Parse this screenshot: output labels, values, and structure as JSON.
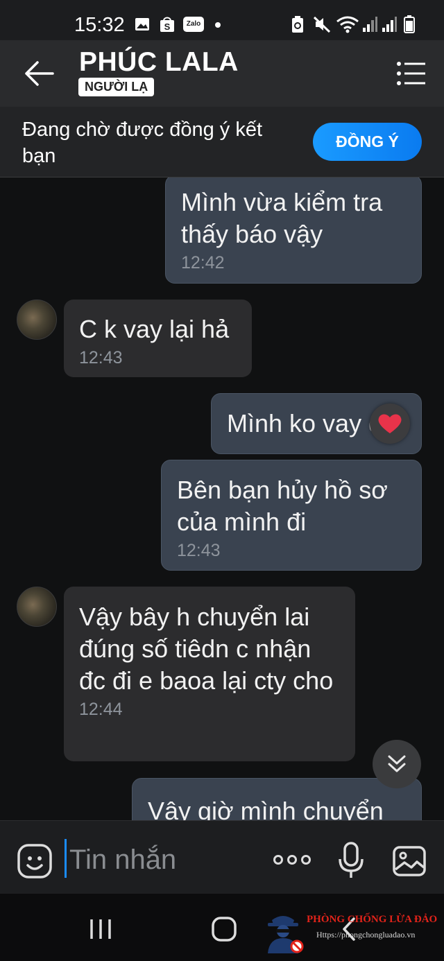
{
  "status_bar": {
    "time": "15:32",
    "icons": [
      "image-icon",
      "shopee-icon",
      "zalo-icon",
      "dot-icon",
      "battery-saver-icon",
      "mute-icon",
      "wifi-icon",
      "signal-icon",
      "signal-icon",
      "battery-icon"
    ],
    "zalo_label": "Zalo"
  },
  "header": {
    "contact_name": "PHÚC LALA",
    "badge": "NGƯỜI LẠ"
  },
  "friend_request": {
    "text": "Đang chờ được đồng ý kết bạn",
    "accept_label": "ĐỒNG Ý"
  },
  "messages": [
    {
      "side": "me",
      "text": "Mình vừa kiểm tra thấy báo vậy",
      "time": "12:42"
    },
    {
      "side": "them",
      "text": "C k vay lại hả",
      "time": "12:43"
    },
    {
      "side": "me",
      "text": "Mình ko vay đi",
      "time": "",
      "reaction": "heart-icon"
    },
    {
      "side": "me",
      "text": "Bên bạn hủy hồ sơ của mình đi",
      "time": "12:43"
    },
    {
      "side": "them",
      "text": "Vậy bây h chuyển lai đúng số tiêdn c nhận đc đi e baoa lại cty cho",
      "time": "12:44"
    },
    {
      "side": "me",
      "text": "Vậy giờ mình chuyển",
      "time": ""
    }
  ],
  "composer": {
    "placeholder": "Tin nhắn"
  },
  "watermark": {
    "title": "PHÒNG CHỐNG LỪA ĐẢO",
    "url": "Https://phongchongluadao.vn"
  },
  "colors": {
    "accent": "#1a8cff",
    "my_bubble": "#3a4350",
    "their_bubble": "#2c2c2e",
    "header_bg": "#2a2b2d",
    "reaction_heart": "#e8334a",
    "watermark_red": "#e2231a"
  }
}
